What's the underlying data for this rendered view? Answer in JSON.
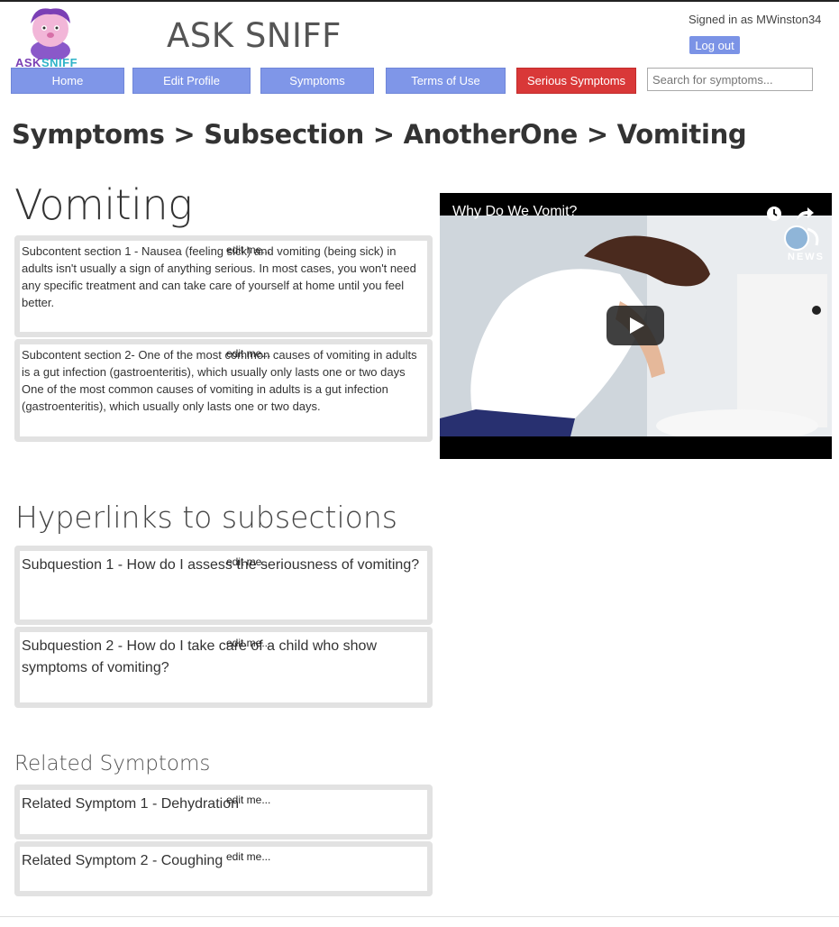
{
  "app": {
    "title": "ASK SNIFF",
    "logo_text_a": "ASK",
    "logo_text_b": "SNIFF"
  },
  "user": {
    "signed_in": "Signed in as MWinston34",
    "logout": "Log out"
  },
  "nav": [
    {
      "label": "Home"
    },
    {
      "label": "Edit Profile"
    },
    {
      "label": "Symptoms"
    },
    {
      "label": "Terms of Use"
    },
    {
      "label": "Serious Symptoms"
    }
  ],
  "search": {
    "placeholder": "Search for symptoms..."
  },
  "breadcrumb": "Symptoms > Subsection > AnotherOne > Vomiting",
  "page_title": "Vomiting",
  "subcontent": [
    {
      "text": "Subcontent section 1 - Nausea (feeling sick) and vomiting (being sick) in adults isn't usually a sign of anything serious. In most cases, you won't need any specific treatment and can take care of yourself at home until you feel better.",
      "edit": "edit me..."
    },
    {
      "text": "Subcontent section 2- One of the most common causes of vomiting in adults is a gut infection (gastroenteritis), which usually only lasts one or two days One of the most common causes of vomiting in adults is a gut infection (gastroenteritis), which usually only lasts one or two days.",
      "edit": "edit me..."
    }
  ],
  "video": {
    "title": "Why Do We Vomit?",
    "badge": "NEWS"
  },
  "hyperlinks_heading": "Hyperlinks to subsections",
  "subquestions": [
    {
      "text": "Subquestion 1 - How do I assess the seriousness of vomiting?",
      "edit": "edit me..."
    },
    {
      "text": "Subquestion 2 - How do I take care of a child who show symptoms of vomiting?",
      "edit": "edit me..."
    }
  ],
  "related_heading": "Related Symptoms",
  "related": [
    {
      "text": "Related Symptom 1 - Dehydration",
      "edit": "edit me..."
    },
    {
      "text": "Related Symptom 2 - Coughing",
      "edit": "edit me..."
    }
  ],
  "colors": {
    "nav": "#7f96e8",
    "serious": "#d93838",
    "card_border": "#e2e2e2"
  }
}
